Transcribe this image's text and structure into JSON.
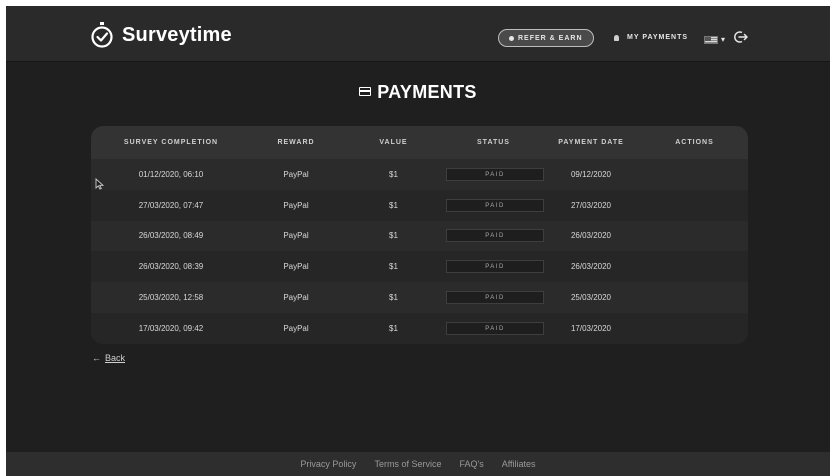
{
  "header": {
    "brand": "Surveytime",
    "refer_label": "REFER & EARN",
    "my_payments_label": "MY PAYMENTS",
    "caret": "▾"
  },
  "page": {
    "title": "PAYMENTS"
  },
  "table": {
    "columns": [
      "SURVEY COMPLETION",
      "REWARD",
      "VALUE",
      "STATUS",
      "PAYMENT DATE",
      "ACTIONS"
    ],
    "rows": [
      {
        "completion": "01/12/2020, 06:10",
        "reward": "PayPal",
        "value": "$1",
        "status": "PAID",
        "payment_date": "09/12/2020"
      },
      {
        "completion": "27/03/2020, 07:47",
        "reward": "PayPal",
        "value": "$1",
        "status": "PAID",
        "payment_date": "27/03/2020"
      },
      {
        "completion": "26/03/2020, 08:49",
        "reward": "PayPal",
        "value": "$1",
        "status": "PAID",
        "payment_date": "26/03/2020"
      },
      {
        "completion": "26/03/2020, 08:39",
        "reward": "PayPal",
        "value": "$1",
        "status": "PAID",
        "payment_date": "26/03/2020"
      },
      {
        "completion": "25/03/2020, 12:58",
        "reward": "PayPal",
        "value": "$1",
        "status": "PAID",
        "payment_date": "25/03/2020"
      },
      {
        "completion": "17/03/2020, 09:42",
        "reward": "PayPal",
        "value": "$1",
        "status": "PAID",
        "payment_date": "17/03/2020"
      }
    ]
  },
  "back": {
    "arrow": "←",
    "label": "Back"
  },
  "footer": {
    "links": [
      "Privacy Policy",
      "Terms of Service",
      "FAQ's",
      "Affiliates"
    ]
  },
  "colors": {
    "background": "#1f1f1f",
    "header": "#2a2a2a",
    "card": "#262626",
    "text": "#d8d8d8"
  },
  "icons": [
    "stopwatch-check-icon",
    "bell-icon",
    "us-flag-icon",
    "logout-icon",
    "card-icon",
    "arrow-left-icon",
    "mouse-cursor-icon"
  ]
}
